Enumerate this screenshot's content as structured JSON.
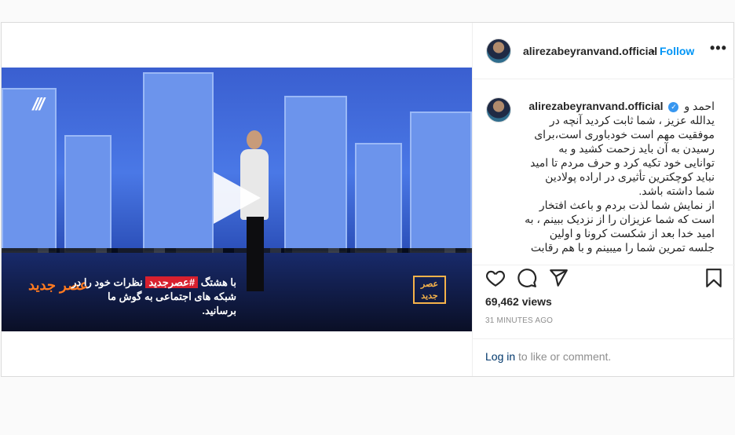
{
  "post": {
    "username": "alirezabeyranvand.official",
    "follow_label": "Follow",
    "separator": "•",
    "more_label": "•••",
    "verified_glyph": "✓",
    "caption_lines": [
      "احمد و",
      "یدالله عزیز ، شما ثابت کردید آنچه در",
      "موفقیت مهم است خودباوری است،برای",
      "رسیدن به آن باید زحمت کشید و به",
      "توانایی خود تکیه کرد و حرف مردم تا امید",
      "نباید کوچکترین تأثیری در اراده پولادین",
      "شما داشته باشد.",
      "از نمایش شما لذت بردم و باعث افتخار",
      "است که شما عزیزان را از نزدیک ببینم ، به",
      "امید خدا بعد از شکست کرونا و اولین",
      "جلسه تمرین شما را میبینم و با هم رقابت"
    ],
    "views": "69,462 views",
    "time_ago": "31 MINUTES AGO",
    "login_link": "Log in",
    "login_rest": " to like or comment."
  },
  "video": {
    "banner_prefix": "با هشتگ",
    "banner_tag": "#عصرجدید",
    "banner_suffix": "نظرات خود را در",
    "banner_line2": "شبکه های اجتماعی به گوش ما برسانید.",
    "logo_left": "عصر جدید",
    "logo_right": "عصر جدید"
  },
  "icons": {
    "like": "heart-icon",
    "comment": "comment-icon",
    "share": "share-icon",
    "save": "bookmark-icon",
    "play": "play-icon"
  }
}
